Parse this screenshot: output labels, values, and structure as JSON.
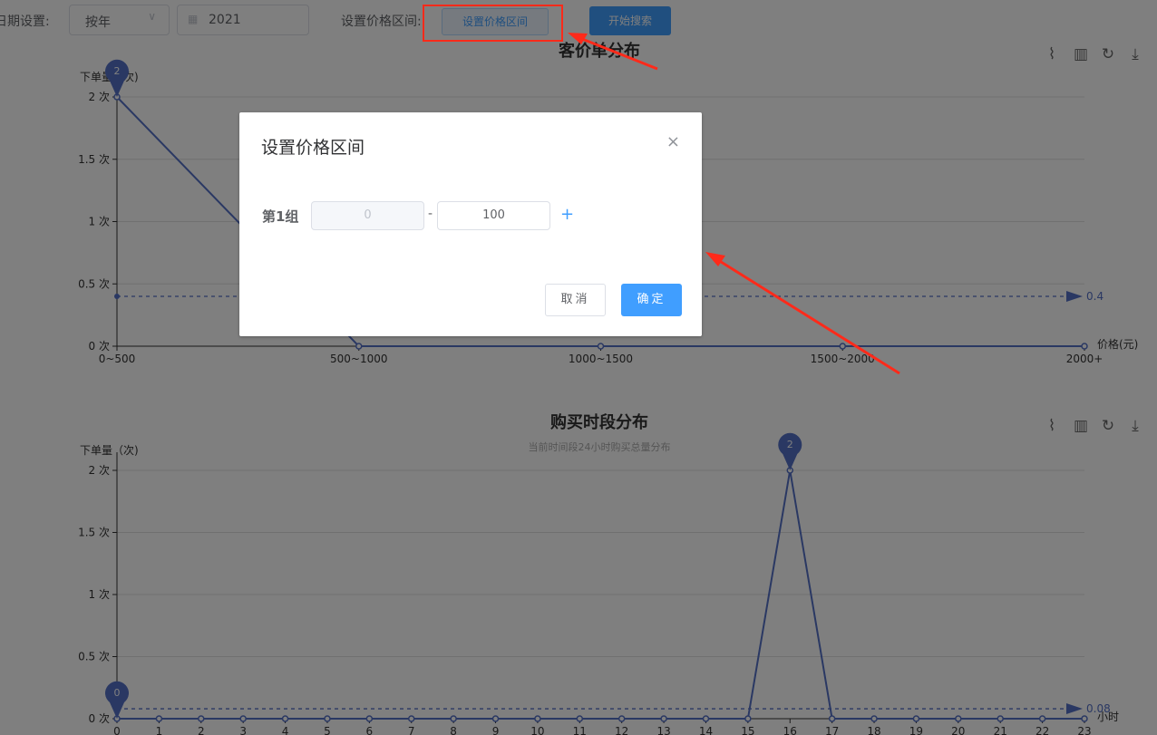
{
  "toolbar": {
    "date_label": "日期设置:",
    "period_value": "按年",
    "year_value": "2021",
    "price_range_label": "设置价格区间:",
    "price_range_button": "设置价格区间",
    "search_button": "开始搜索"
  },
  "chart_data": [
    {
      "type": "line",
      "title": "客价单分布",
      "ylabel": "下单量（次)",
      "xlabel": "价格(元)",
      "categories": [
        "0~500",
        "500~1000",
        "1000~1500",
        "1500~2000",
        "2000+"
      ],
      "values": [
        2,
        0,
        0,
        0,
        0
      ],
      "ylim": [
        0,
        2
      ],
      "y_ticks": [
        "0 次",
        "0.5 次",
        "1 次",
        "1.5 次",
        "2 次"
      ],
      "max_marker": "2",
      "average_value": "0.4",
      "toolbox": [
        "line-chart-icon",
        "bar-chart-icon",
        "restore-icon",
        "download-icon"
      ]
    },
    {
      "type": "line",
      "title": "购买时段分布",
      "subtitle": "当前时间段24小时购买总量分布",
      "ylabel": "下单量（次)",
      "xlabel": "小时",
      "categories": [
        "0",
        "1",
        "2",
        "3",
        "4",
        "5",
        "6",
        "7",
        "8",
        "9",
        "10",
        "11",
        "12",
        "13",
        "14",
        "15",
        "16",
        "17",
        "18",
        "19",
        "20",
        "21",
        "22",
        "23"
      ],
      "values": [
        0,
        0,
        0,
        0,
        0,
        0,
        0,
        0,
        0,
        0,
        0,
        0,
        0,
        0,
        0,
        0,
        2,
        0,
        0,
        0,
        0,
        0,
        0,
        0
      ],
      "ylim": [
        0,
        2
      ],
      "y_ticks": [
        "0 次",
        "0.5 次",
        "1 次",
        "1.5 次",
        "2 次"
      ],
      "max_marker": "2",
      "min_marker": "0",
      "average_value": "0.08",
      "toolbox": [
        "line-chart-icon",
        "bar-chart-icon",
        "restore-icon",
        "download-icon"
      ]
    }
  ],
  "dialog": {
    "title": "设置价格区间",
    "group_label": "第1组",
    "min_value": "0",
    "max_value": "100",
    "separator": "-",
    "add_icon": "+",
    "close_icon": "×",
    "cancel": "取消",
    "confirm": "确定"
  },
  "colors": {
    "line": "#5470c6",
    "primary": "#409eff",
    "annotation": "#ff2a1a"
  }
}
